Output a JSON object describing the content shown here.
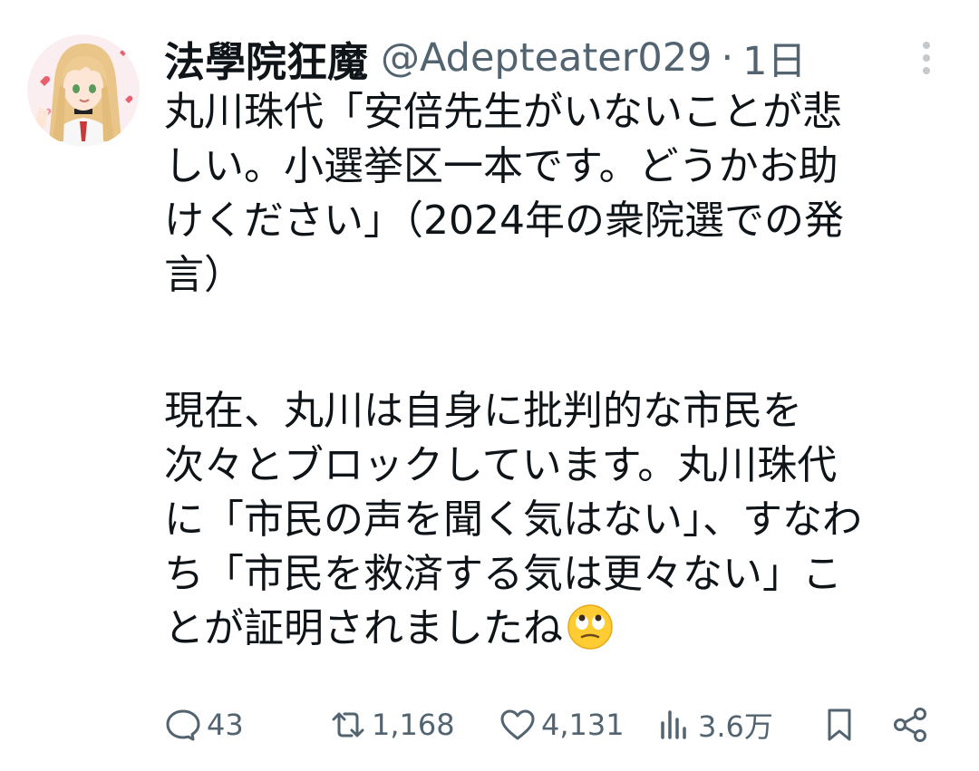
{
  "tweet": {
    "display_name": "法學院狂魔",
    "handle": "@Adepteater029",
    "separator": "·",
    "time": "1日",
    "text_lines_1": [
      "丸川珠代「安倍先生がいないことが悲",
      "しい。小選挙区一本です。どうかお助",
      "けください」（2024年の衆院選での発",
      "言）"
    ],
    "text_lines_2": [
      "現在、丸川は自身に批判的な市民を",
      "次々とブロックしています。丸川珠代",
      "に「市民の声を聞く気はない」、すなわ",
      "ち「市民を救済する気は更々ない」こ",
      "とが証明されましたね"
    ],
    "emoji": "face-with-rolling-eyes"
  },
  "actions": {
    "replies": "43",
    "reposts": "1,168",
    "likes": "4,131",
    "views": "3.6万"
  },
  "colors": {
    "text": "#0f1419",
    "secondary": "#536471",
    "background": "#ffffff"
  }
}
